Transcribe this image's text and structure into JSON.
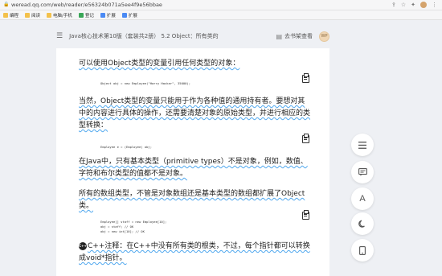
{
  "browser": {
    "url": "weread.qq.com/web/reader/e56324b071a5ee4f9e56bbae",
    "bookmarks": [
      {
        "label": "编程"
      },
      {
        "label": "阅读"
      },
      {
        "label": "电脑/手机"
      },
      {
        "label": "登记"
      },
      {
        "label": "扩展"
      },
      {
        "label": "扩展"
      }
    ]
  },
  "reader": {
    "header_title": "Java核心技术第10版（套装共2册）   5.2 Object：所有类的",
    "shelf_label": "去书架查看",
    "avatar_text": "WP"
  },
  "content": {
    "p1": "可以使用Object类型的变量引用任何类型的对象：",
    "code1": "Object obj = new Employee(\"Harry Hacker\", 35000);",
    "p2": "当然，Object类型的变量只能用于作为各种值的通用持有者。要想对其中的内容进行具体的操作，还需要清楚对象的原始类型，并进行相应的类型转换：",
    "code2": "Employee e = (Employee) obj;",
    "p3": "在Java中，只有基本类型（primitive types）不是对象，例如，数值、字符和布尔类型的值都不是对象。",
    "p4": "所有的数组类型，不管是对象数组还是基本类型的数组都扩展了Object类。",
    "code3": "Employee[] staff = new Employee[10];\nobj = staff; // OK\nobj = new int[10]; // OK",
    "badge": "C++",
    "p5": "C++注释：在C++中没有所有类的根类，不过，每个指针都可以转换成void*指针。"
  },
  "toolbar": {
    "items": [
      "catalog",
      "notes",
      "font",
      "theme",
      "mobile"
    ]
  }
}
